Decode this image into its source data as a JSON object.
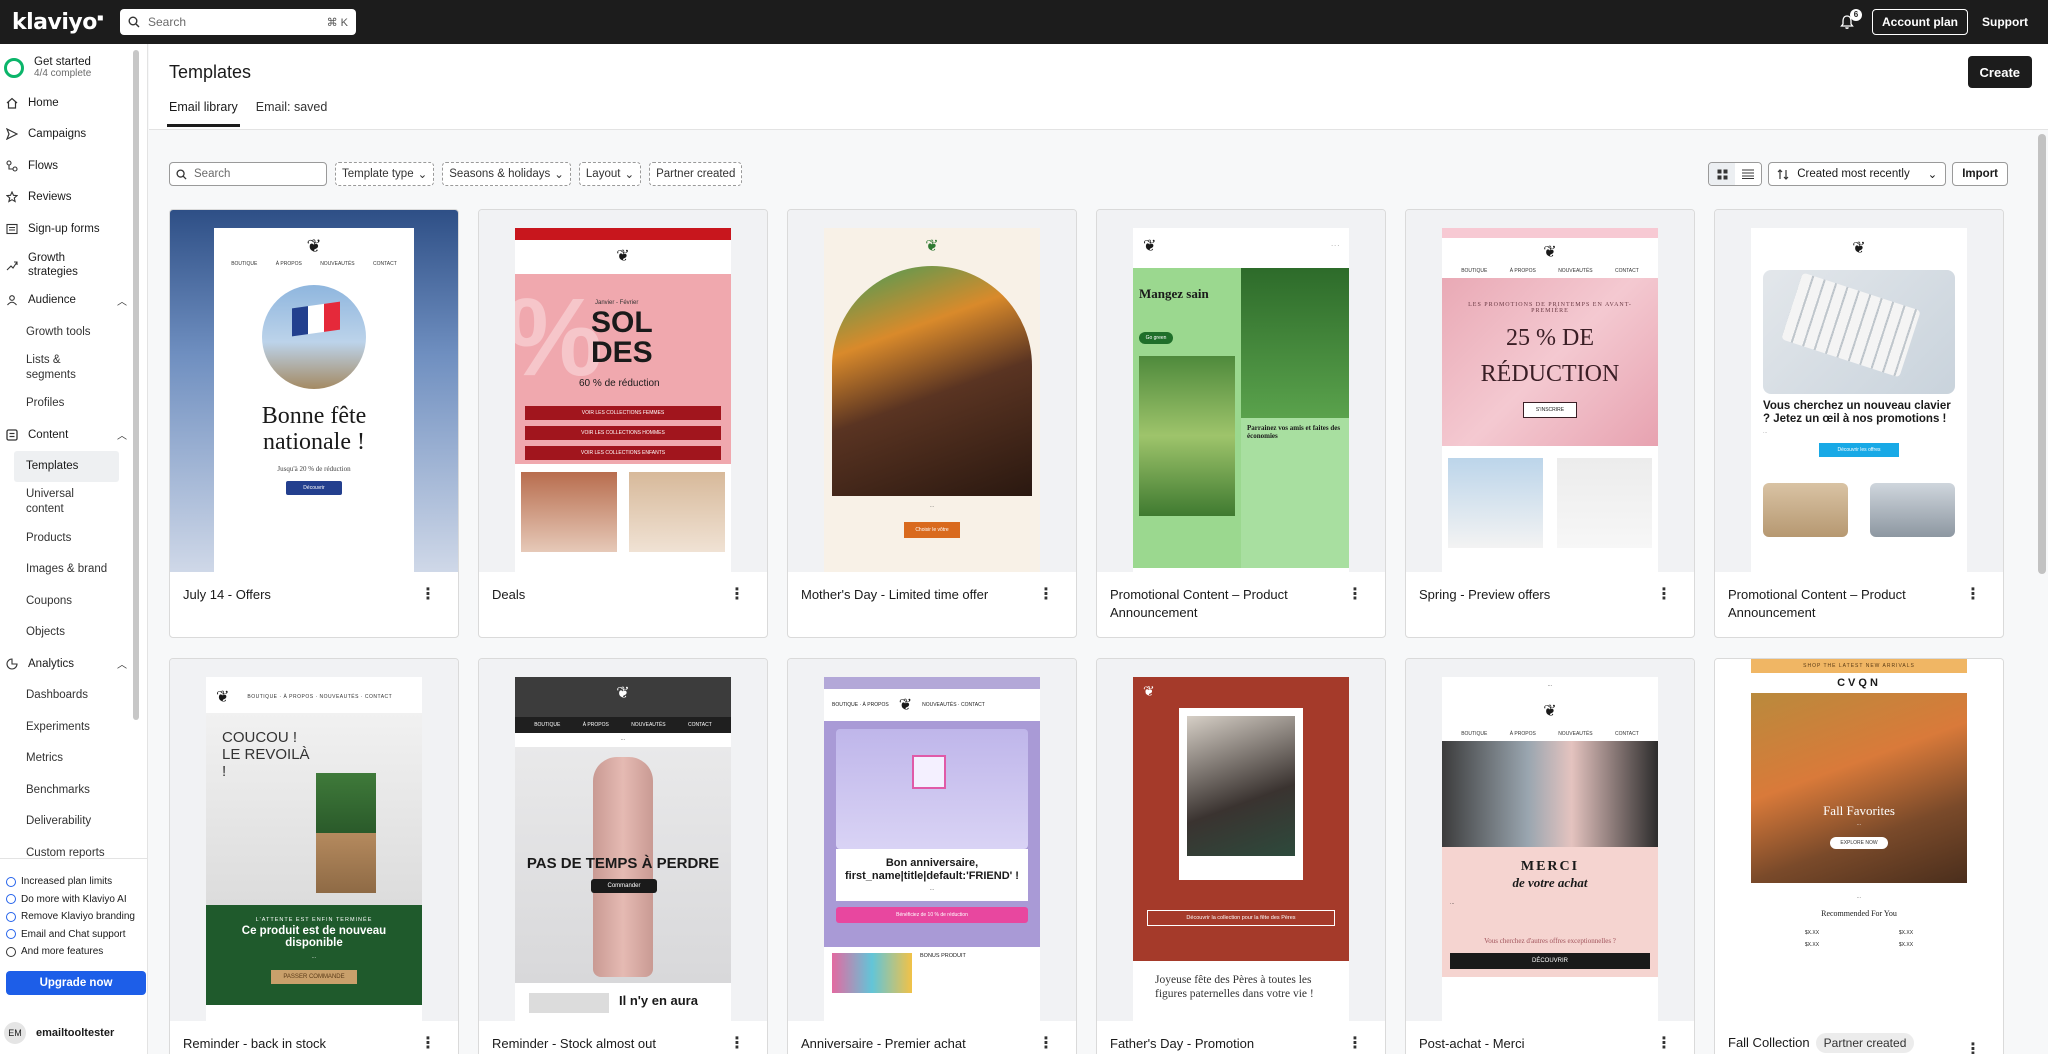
{
  "topbar": {
    "logo": "klaviyo",
    "search_placeholder": "Search",
    "search_shortcut": "⌘ K",
    "notification_count": "6",
    "account_plan_label": "Account plan",
    "support_label": "Support"
  },
  "sidebar": {
    "get_started_title": "Get started",
    "get_started_sub": "4/4 complete",
    "items": {
      "home": "Home",
      "campaigns": "Campaigns",
      "flows": "Flows",
      "reviews": "Reviews",
      "signup_forms": "Sign-up forms",
      "growth_strategies": "Growth strategies",
      "audience": "Audience",
      "growth_tools": "Growth tools",
      "lists_segments": "Lists & segments",
      "profiles": "Profiles",
      "content": "Content",
      "templates": "Templates",
      "universal_content": "Universal content",
      "products": "Products",
      "images_brand": "Images & brand",
      "coupons": "Coupons",
      "objects": "Objects",
      "analytics": "Analytics",
      "dashboards": "Dashboards",
      "experiments": "Experiments",
      "metrics": "Metrics",
      "benchmarks": "Benchmarks",
      "deliverability": "Deliverability",
      "custom_reports": "Custom reports"
    },
    "upsell": [
      "Increased plan limits",
      "Do more with Klaviyo AI",
      "Remove Klaviyo branding",
      "Email and Chat support",
      "And more features"
    ],
    "upgrade_label": "Upgrade now",
    "user_initials": "EM",
    "user_name": "emailtooltester"
  },
  "main": {
    "title": "Templates",
    "create_label": "Create",
    "tabs": [
      "Email library",
      "Email: saved"
    ],
    "filters": {
      "search_placeholder": "Search",
      "template_type": "Template type",
      "seasons": "Seasons & holidays",
      "layout": "Layout",
      "partner": "Partner created"
    },
    "sort_label": "Created most recently",
    "import_label": "Import"
  },
  "cards": [
    {
      "name": "July 14 - Offers"
    },
    {
      "name": "Deals"
    },
    {
      "name": "Mother's Day - Limited time offer"
    },
    {
      "name": "Promotional Content – Product Announcement"
    },
    {
      "name": "Spring - Preview offers"
    },
    {
      "name": "Promotional Content – Product Announcement"
    },
    {
      "name": "Reminder - back in stock"
    },
    {
      "name": "Reminder - Stock almost out"
    },
    {
      "name": "Anniversaire - Premier achat"
    },
    {
      "name": "Father's Day - Promotion"
    },
    {
      "name": "Post-achat - Merci"
    },
    {
      "name": "Fall Collection",
      "badge": "Partner created"
    }
  ],
  "thumbs": {
    "july": {
      "headline": "Bonne fête nationale !",
      "sub": "Jusqu'à 20 % de réduction",
      "btn": "Découvrir"
    },
    "deals": {
      "headline": "SOLDES",
      "pct": "60 % de réduction",
      "date": "Janvier - Février",
      "b1": "VOIR LES COLLECTIONS FEMMES",
      "b2": "VOIR LES COLLECTIONS HOMMES",
      "b3": "VOIR LES COLLECTIONS ENFANTS"
    },
    "mother": {
      "btn": "Choisir le vôtre"
    },
    "promo1": {
      "headline": "Mangez sain",
      "btn": "Go green",
      "side": "Parrainez vos amis et faites des économies"
    },
    "spring": {
      "headline": "25 % DE RÉDUCTION",
      "kicker": "LES PROMOTIONS DE PRINTEMPS EN AVANT-PREMIÈRE",
      "btn": "S'INSCRIRE"
    },
    "promo2": {
      "headline": "Vous cherchez un nouveau clavier ? Jetez un œil à nos promotions !",
      "btn": "Découvrir les offres"
    },
    "stock": {
      "headline": "COUCOU ! LE REVOILÀ !",
      "kicker": "L'ATTENTE EST ENFIN TERMINÉE",
      "sub": "Ce produit est de nouveau disponible",
      "btn": "PASSER COMMANDE"
    },
    "almost": {
      "headline": "PAS DE TEMPS À PERDRE",
      "btn": "Commander",
      "footer": "Il n'y en aura"
    },
    "anniv": {
      "headline": "Bon anniversaire, first_name|title|default:'FRIEND' !",
      "btn": "Bénéficiez de 10 % de réduction",
      "bonus": "BONUS PRODUIT"
    },
    "father": {
      "btn": "Découvrir la collection pour la fête des Pères",
      "headline": "Joyeuse fête des Pères à toutes les figures paternelles dans votre vie !"
    },
    "merci": {
      "headline": "MERCI",
      "sub": "de votre achat",
      "q": "Vous cherchez d'autres offres exceptionnelles ?",
      "btn": "DÉCOUVRIR"
    },
    "fall": {
      "banner": "SHOP THE LATEST NEW ARRIVALS",
      "brand": "CVQN",
      "headline": "Fall Favorites",
      "btn": "EXPLORE NOW",
      "rec": "Recommended For You",
      "price": "$X.XX"
    }
  },
  "colors": {
    "topbar": "#1c1c1c",
    "accent_blue": "#1d5ee8",
    "progress_green": "#0bb56a"
  }
}
